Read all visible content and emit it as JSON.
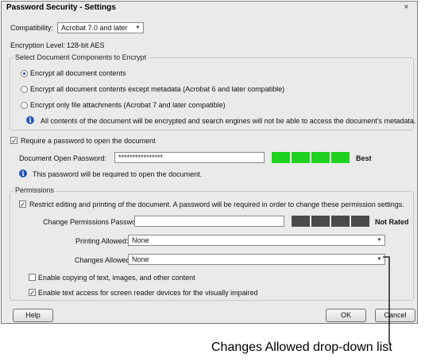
{
  "window": {
    "title": "Password Security - Settings",
    "close_glyph": "×"
  },
  "compatibility": {
    "label": "Compatibility:",
    "value": "Acrobat 7.0 and later"
  },
  "encryption": {
    "label": "Encryption  Level:",
    "value": "128-bit AES"
  },
  "components": {
    "legend": "Select Document Components to Encrypt",
    "options": [
      "Encrypt all document contents",
      "Encrypt all document contents except metadata (Acrobat 6 and later compatible)",
      "Encrypt only file attachments (Acrobat 7 and later compatible)"
    ],
    "selected_index": 0,
    "info": "All contents of the document will be encrypted and search engines will not be able to access the document's metadata."
  },
  "open_password": {
    "checkbox_label": "Require a password to open the document",
    "checked": true,
    "field_label": "Document Open Password:",
    "value": "****************",
    "strength_label": "Best",
    "strength_color": "#1fd21f",
    "info": "This password will be required to open the document."
  },
  "permissions": {
    "legend": "Permissions",
    "restrict_label": "Restrict editing and printing of the document. A password will be required in order to change these permission settings.",
    "restrict_checked": true,
    "change_password_label": "Change Permissions Password:",
    "change_password_value": "",
    "strength_label": "Not Rated",
    "strength_color": "#4a4a4a",
    "printing_label": "Printing Allowed:",
    "printing_value": "None",
    "changes_label": "Changes Allowed:",
    "changes_value": "None",
    "copy_label": "Enable copying of text, images, and other content",
    "copy_checked": false,
    "screen_reader_label": "Enable text access for screen reader devices for the visually impaired",
    "screen_reader_checked": true
  },
  "buttons": {
    "help": "Help",
    "ok": "OK",
    "cancel": "Cancel"
  },
  "callout": "Changes Allowed drop-down list"
}
